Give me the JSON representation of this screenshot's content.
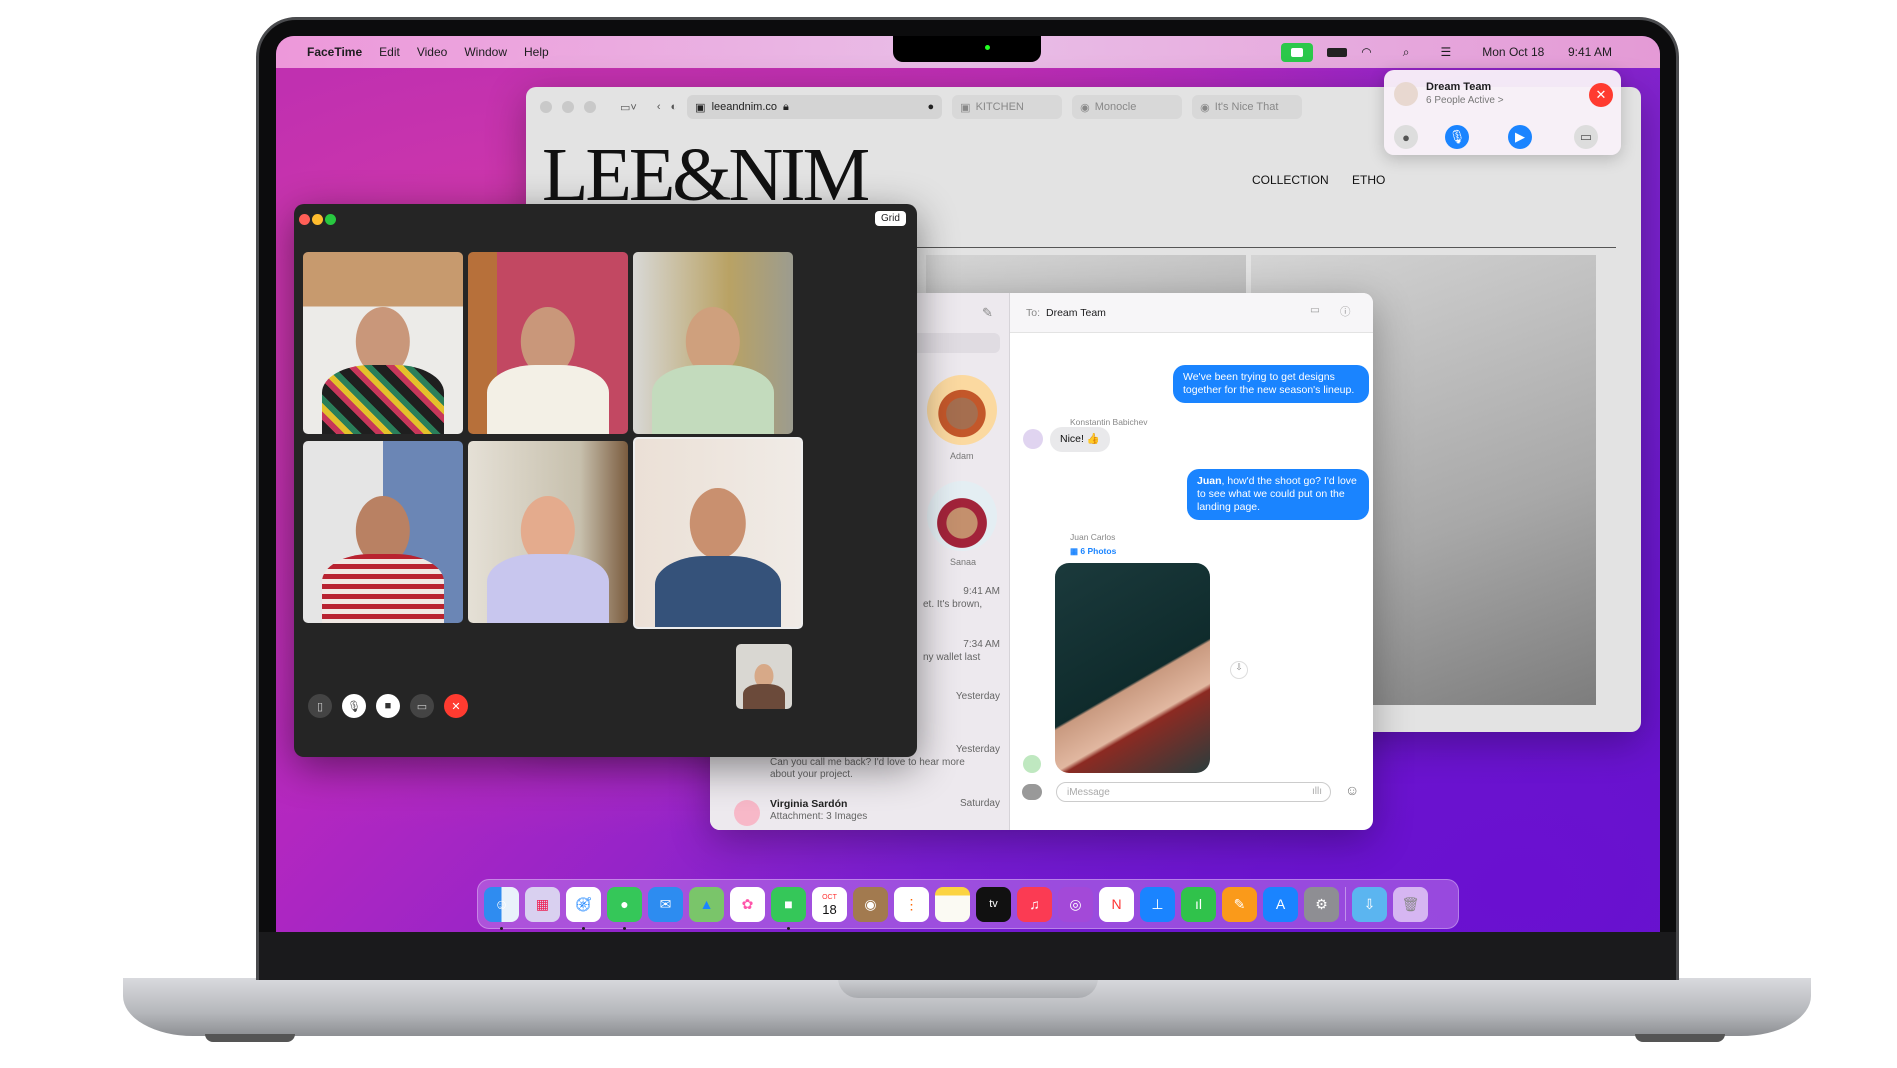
{
  "menubar": {
    "apple": "",
    "app": "FaceTime",
    "items": [
      "Edit",
      "Video",
      "Window",
      "Help"
    ],
    "date": "Mon Oct 18",
    "time": "9:41 AM",
    "icons": [
      "facetime-video-indicator",
      "battery-icon",
      "wifi-icon",
      "search-icon",
      "control-center-icon"
    ]
  },
  "safari": {
    "url": "leeandnim.co",
    "tabs": [
      "KITCHEN",
      "Monocle",
      "It's Nice That"
    ],
    "logo": "LEE&NIM",
    "nav": [
      "COLLECTION",
      "ETHO"
    ]
  },
  "notification": {
    "title": "Dream Team",
    "subtitle": "6 People Active >",
    "colors": {
      "end": "#ff3b30",
      "active": "#1a84ff"
    }
  },
  "facetime": {
    "grid_label": "Grid",
    "participants": 6
  },
  "messages": {
    "to_label": "To:",
    "to": "Dream Team",
    "pinned": [
      {
        "name": "Adam"
      },
      {
        "name": "Sanaa"
      }
    ],
    "list": [
      {
        "time": "9:41 AM",
        "preview": "et. It's brown,"
      },
      {
        "time": "7:34 AM",
        "preview": "ny wallet last"
      },
      {
        "time": "Yesterday",
        "preview": ""
      },
      {
        "time": "Yesterday",
        "preview": "Can you call me back? I'd love to hear more about your project."
      },
      {
        "name": "Virginia Sardón",
        "time": "Saturday",
        "preview": "Attachment: 3 Images"
      }
    ],
    "thread": [
      {
        "from": "me",
        "text": "We've been trying to get designs together for the new season's lineup."
      },
      {
        "from": "Konstantin Babichev",
        "text": "Nice! 👍"
      },
      {
        "from": "me",
        "bold": "Juan",
        "text": ", how'd the shoot go? I'd love to see what we could put on the landing page."
      },
      {
        "from": "Juan Carlos",
        "attachment": "6 Photos"
      }
    ],
    "input_placeholder": "iMessage"
  },
  "dock": {
    "apps": [
      "Finder",
      "Launchpad",
      "Safari",
      "Messages",
      "Mail",
      "Maps",
      "Photos",
      "FaceTime",
      "Calendar",
      "Contacts",
      "Reminders",
      "Notes",
      "TV",
      "Music",
      "Podcasts",
      "News",
      "Keynote",
      "Numbers",
      "Pages",
      "App Store",
      "System Preferences",
      "Downloads",
      "Trash"
    ],
    "calendar_month": "OCT",
    "calendar_day": "18",
    "tv_label": "tv"
  }
}
